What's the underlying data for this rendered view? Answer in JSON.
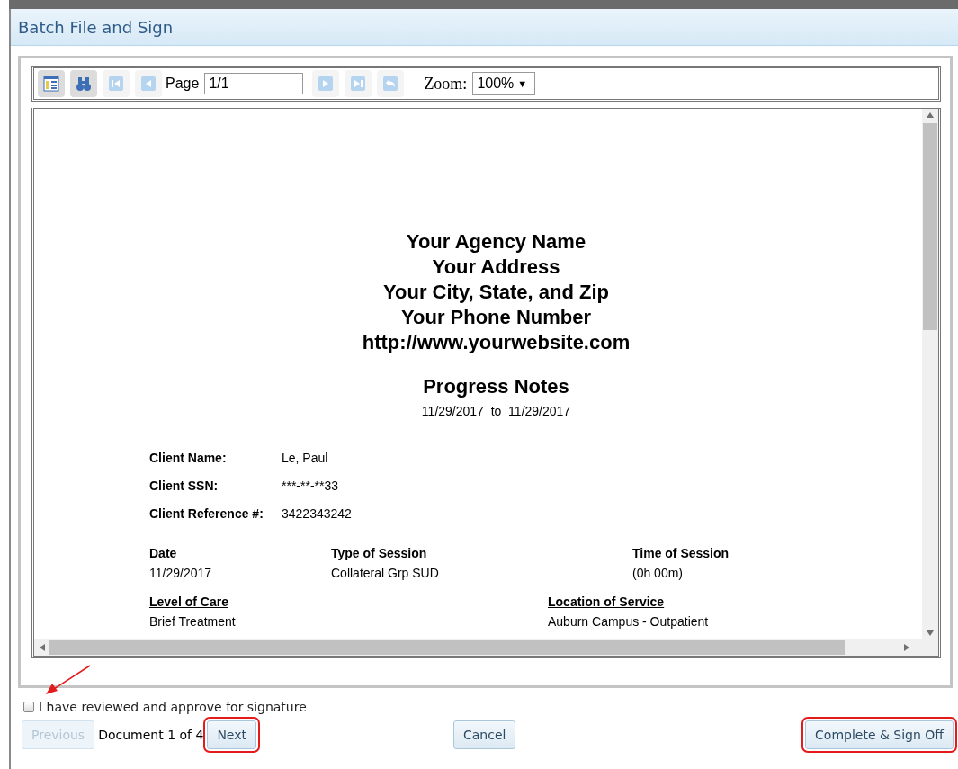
{
  "dialog": {
    "title": "Batch File and Sign"
  },
  "toolbar": {
    "buttons": [
      {
        "kind": "toc",
        "disabled": false
      },
      {
        "kind": "find",
        "disabled": false
      },
      {
        "kind": "first",
        "disabled": true
      },
      {
        "kind": "prev",
        "disabled": true
      }
    ],
    "page_label": "Page",
    "page_value": "1/1",
    "buttons_after": [
      {
        "kind": "next",
        "disabled": true
      },
      {
        "kind": "last",
        "disabled": true
      },
      {
        "kind": "back",
        "disabled": true
      }
    ],
    "zoom_label": "Zoom:",
    "zoom_value": "100%",
    "zoom_caret": "▼"
  },
  "document": {
    "header": [
      "Your Agency Name",
      "Your Address",
      "Your City, State, and Zip",
      "Your Phone Number",
      "http://www.yourwebsite.com"
    ],
    "title": "Progress Notes",
    "date_range": "11/29/2017  to  11/29/2017",
    "fields": [
      {
        "label": "Client Name:",
        "value": "Le, Paul"
      },
      {
        "label": "Client SSN:",
        "value": "***-**-**33"
      },
      {
        "label": "Client Reference #:",
        "value": "3422343242"
      }
    ],
    "sections": [
      {
        "columns": [
          {
            "heading": "Date",
            "value": "11/29/2017"
          },
          {
            "heading": "Type of Session",
            "value": "Collateral Grp SUD"
          },
          {
            "heading": "Time of Session",
            "value": " (0h 00m)"
          }
        ]
      },
      {
        "columns": [
          {
            "heading": "Level of Care",
            "value": "Brief Treatment"
          },
          {
            "heading": "Location of Service",
            "value": "Auburn Campus - Outpatient"
          }
        ]
      }
    ]
  },
  "approval": {
    "label": "I have reviewed and approve for signature",
    "checked": false,
    "annotated": true
  },
  "footer": {
    "previous": {
      "label": "Previous",
      "disabled": true,
      "highlighted": false
    },
    "counter": "Document 1 of 4",
    "next": {
      "label": "Next",
      "disabled": false,
      "highlighted": true
    },
    "cancel": {
      "label": "Cancel",
      "disabled": false,
      "highlighted": false
    },
    "complete": {
      "label": "Complete & Sign Off",
      "disabled": false,
      "highlighted": true
    }
  }
}
